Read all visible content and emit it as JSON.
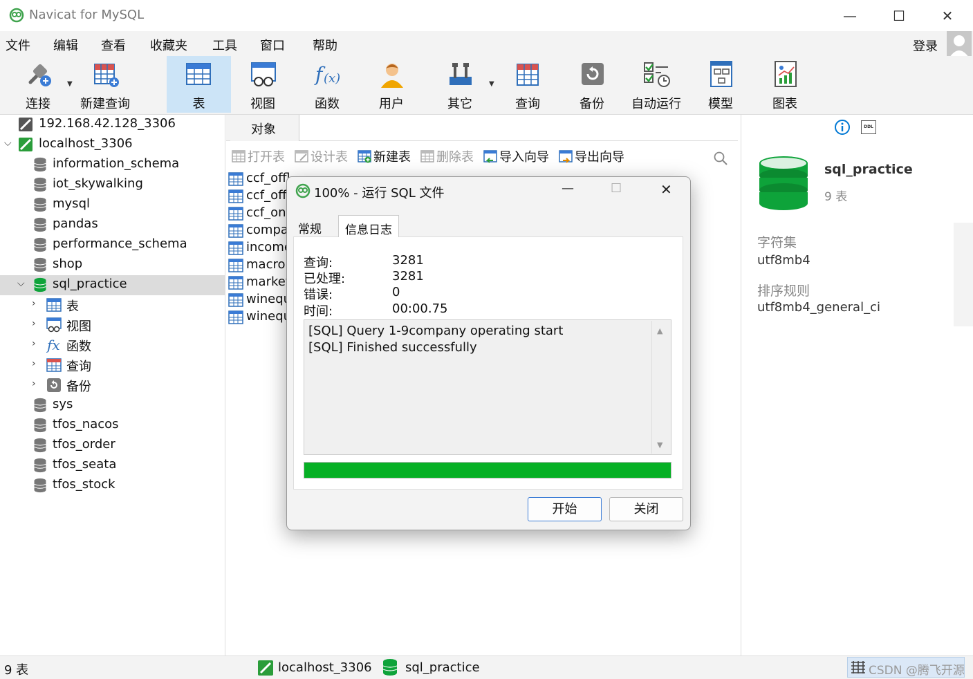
{
  "window": {
    "title": "Navicat for MySQL",
    "minimize": "—",
    "maximize": "☐",
    "close": "✕"
  },
  "menu": [
    "文件",
    "编辑",
    "查看",
    "收藏夹",
    "工具",
    "窗口",
    "帮助"
  ],
  "login_label": "登录",
  "toolbar": [
    {
      "label": "连接",
      "icon": "plug-icon"
    },
    {
      "label": "新建查询",
      "icon": "new-query-icon"
    },
    {
      "label": "表",
      "icon": "table-icon",
      "active": true
    },
    {
      "label": "视图",
      "icon": "view-icon"
    },
    {
      "label": "函数",
      "icon": "function-icon"
    },
    {
      "label": "用户",
      "icon": "user-icon"
    },
    {
      "label": "其它",
      "icon": "tools-icon"
    },
    {
      "label": "查询",
      "icon": "query-icon"
    },
    {
      "label": "备份",
      "icon": "backup-icon"
    },
    {
      "label": "自动运行",
      "icon": "autorun-icon"
    },
    {
      "label": "模型",
      "icon": "model-icon"
    },
    {
      "label": "图表",
      "icon": "chart-icon"
    }
  ],
  "tree": [
    {
      "label": "192.168.42.128_3306",
      "type": "connection"
    },
    {
      "label": "localhost_3306",
      "type": "connection-open",
      "expanded": true
    },
    {
      "label": "information_schema",
      "type": "db"
    },
    {
      "label": "iot_skywalking",
      "type": "db"
    },
    {
      "label": "mysql",
      "type": "db"
    },
    {
      "label": "pandas",
      "type": "db"
    },
    {
      "label": "performance_schema",
      "type": "db"
    },
    {
      "label": "shop",
      "type": "db"
    },
    {
      "label": "sql_practice",
      "type": "db-open",
      "selected": true,
      "expanded": true
    },
    {
      "label": "表",
      "type": "child-table"
    },
    {
      "label": "视图",
      "type": "child-view"
    },
    {
      "label": "函数",
      "type": "child-func"
    },
    {
      "label": "查询",
      "type": "child-query"
    },
    {
      "label": "备份",
      "type": "child-backup"
    },
    {
      "label": "sys",
      "type": "db"
    },
    {
      "label": "tfos_nacos",
      "type": "db"
    },
    {
      "label": "tfos_order",
      "type": "db"
    },
    {
      "label": "tfos_seata",
      "type": "db"
    },
    {
      "label": "tfos_stock",
      "type": "db"
    }
  ],
  "objects": {
    "tab_label": "对象",
    "toolbar": [
      {
        "label": "打开表",
        "enabled": false
      },
      {
        "label": "设计表",
        "enabled": false
      },
      {
        "label": "新建表",
        "enabled": true
      },
      {
        "label": "删除表",
        "enabled": false
      },
      {
        "label": "导入向导",
        "enabled": true
      },
      {
        "label": "导出向导",
        "enabled": true
      }
    ],
    "tables": [
      "ccf_offl",
      "ccf_offl",
      "ccf_onl",
      "compa",
      "income",
      "macro",
      "market",
      "winequ",
      "winequ"
    ]
  },
  "right_panel": {
    "db_name": "sql_practice",
    "table_count": "9 表",
    "charset_label": "字符集",
    "charset_value": "utf8mb4",
    "collation_label": "排序规则",
    "collation_value": "utf8mb4_general_ci",
    "ddl_label": "DDL"
  },
  "statusbar": {
    "count": "9 表",
    "connection": "localhost_3306",
    "database": "sql_practice",
    "watermark": "CSDN @腾飞开源"
  },
  "dialog": {
    "title": "100% - 运行 SQL 文件",
    "tabs": [
      "常规",
      "信息日志"
    ],
    "active_tab": 1,
    "stats": [
      {
        "label": "查询:",
        "value": "3281"
      },
      {
        "label": "已处理:",
        "value": "3281"
      },
      {
        "label": "错误:",
        "value": "0"
      },
      {
        "label": "时间:",
        "value": "00:00.75"
      }
    ],
    "log": [
      "[SQL] Query 1-9company operating start",
      "[SQL] Finished successfully"
    ],
    "progress": 1.0,
    "start_button": "开始",
    "close_button": "关闭",
    "minimize": "—",
    "maximize": "☐",
    "close": "✕"
  },
  "colors": {
    "accent": "#0078d4",
    "progress": "#06b025",
    "db_green": "#0ea33a",
    "selected_tool": "#cce4f7"
  }
}
